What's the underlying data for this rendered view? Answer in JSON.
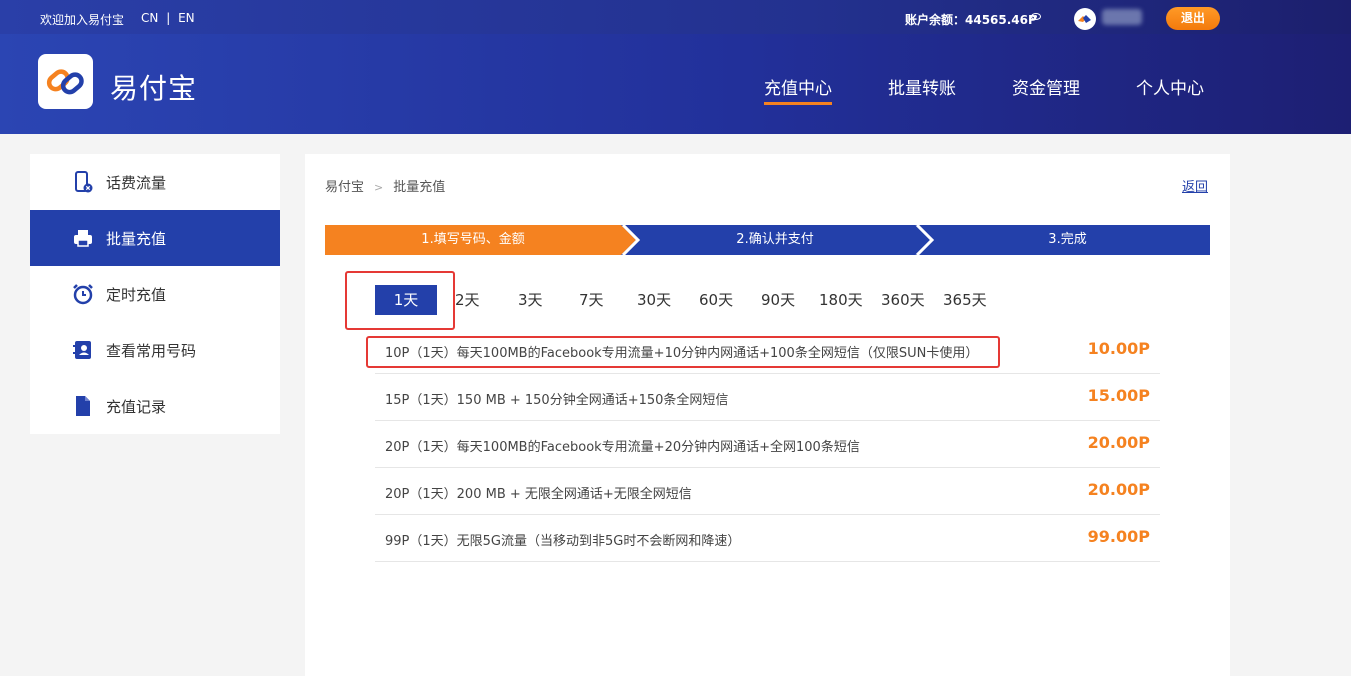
{
  "topbar": {
    "welcome": "欢迎加入易付宝",
    "lang_cn": "CN",
    "lang_sep": "|",
    "lang_en": "EN",
    "balance": "账户余额：44565.46P",
    "logout": "退出"
  },
  "header": {
    "brand": "易付宝",
    "nav": [
      {
        "label": "充值中心",
        "active": true
      },
      {
        "label": "批量转账"
      },
      {
        "label": "资金管理"
      },
      {
        "label": "个人中心"
      }
    ]
  },
  "sidebar": {
    "items": [
      {
        "label": "话费流量",
        "icon": "phone-icon"
      },
      {
        "label": "批量充值",
        "icon": "printer-icon",
        "active": true
      },
      {
        "label": "定时充值",
        "icon": "alarm-clock-icon"
      },
      {
        "label": "查看常用号码",
        "icon": "contact-card-icon"
      },
      {
        "label": "充值记录",
        "icon": "document-icon"
      }
    ]
  },
  "main": {
    "breadcrumb": {
      "root": "易付宝",
      "sep": ">",
      "current": "批量充值"
    },
    "back": "返回",
    "steps": [
      {
        "label": "1.填写号码、金额",
        "active": true
      },
      {
        "label": "2.确认并支付"
      },
      {
        "label": "3.完成"
      }
    ],
    "day_tabs": [
      "1天",
      "2天",
      "3天",
      "7天",
      "30天",
      "60天",
      "90天",
      "180天",
      "360天",
      "365天"
    ],
    "plans": [
      {
        "desc": "10P（1天）每天100MB的Facebook专用流量+10分钟内网通话+100条全网短信（仅限SUN卡使用）",
        "price": "10.00P"
      },
      {
        "desc": "15P（1天）150 MB + 150分钟全网通话+150条全网短信",
        "price": "15.00P"
      },
      {
        "desc": "20P（1天）每天100MB的Facebook专用流量+20分钟内网通话+全网100条短信",
        "price": "20.00P"
      },
      {
        "desc": "20P（1天）200 MB + 无限全网通话+无限全网短信",
        "price": "20.00P"
      },
      {
        "desc": "99P（1天）无限5G流量（当移动到非5G时不会断网和降速）",
        "price": "99.00P"
      }
    ]
  },
  "colors": {
    "primary": "#2340aa",
    "accent": "#f58220",
    "highlight": "#e53935"
  }
}
